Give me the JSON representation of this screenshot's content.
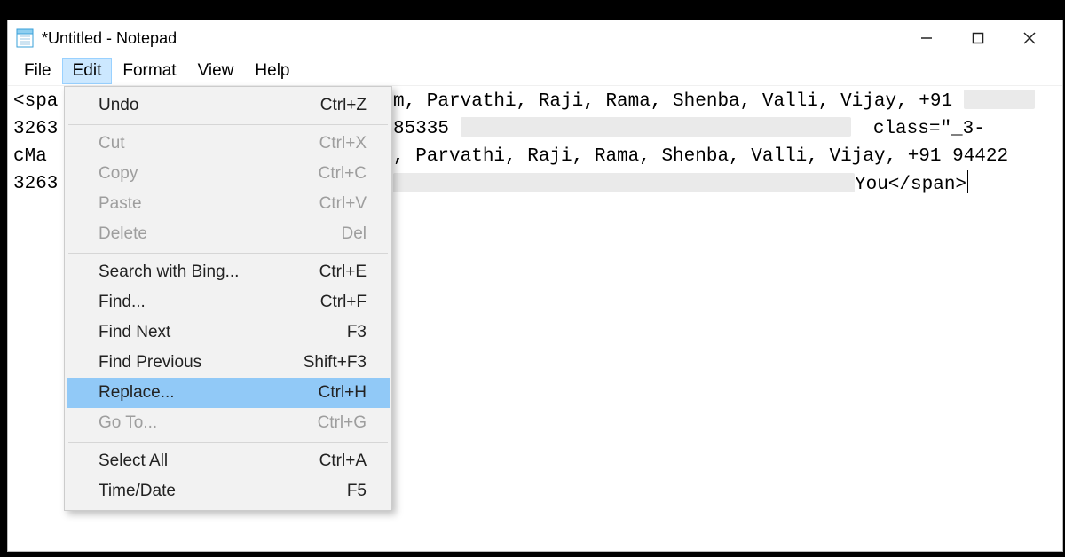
{
  "titlebar": {
    "title": "*Untitled - Notepad"
  },
  "menubar": {
    "file": "File",
    "edit": "Edit",
    "format": "Format",
    "view": "View",
    "help": "Help",
    "active": "edit"
  },
  "editor": {
    "lines": [
      {
        "left": "<spa",
        "right_text": "m, Parvathi, Raji, Rama, Shenba, Valli, Vijay, +91 ",
        "right_tail": ""
      },
      {
        "left": "3263",
        "right_text": "85335",
        "right_tail": "class=\"_3-"
      },
      {
        "left": "cMa",
        "right_text": ", Parvathi, Raji, Rama, Shenba, Valli, Vijay, +91 94422",
        "right_tail": ""
      },
      {
        "left": "3263",
        "right_text": "",
        "right_tail": "You</span>"
      }
    ]
  },
  "edit_menu": {
    "items": [
      {
        "id": "undo",
        "label": "Undo",
        "shortcut": "Ctrl+Z",
        "disabled": false
      },
      {
        "sep": true
      },
      {
        "id": "cut",
        "label": "Cut",
        "shortcut": "Ctrl+X",
        "disabled": true
      },
      {
        "id": "copy",
        "label": "Copy",
        "shortcut": "Ctrl+C",
        "disabled": true
      },
      {
        "id": "paste",
        "label": "Paste",
        "shortcut": "Ctrl+V",
        "disabled": true
      },
      {
        "id": "delete",
        "label": "Delete",
        "shortcut": "Del",
        "disabled": true
      },
      {
        "sep": true
      },
      {
        "id": "bing",
        "label": "Search with Bing...",
        "shortcut": "Ctrl+E",
        "disabled": false
      },
      {
        "id": "find",
        "label": "Find...",
        "shortcut": "Ctrl+F",
        "disabled": false
      },
      {
        "id": "findnext",
        "label": "Find Next",
        "shortcut": "F3",
        "disabled": false
      },
      {
        "id": "findprev",
        "label": "Find Previous",
        "shortcut": "Shift+F3",
        "disabled": false
      },
      {
        "id": "replace",
        "label": "Replace...",
        "shortcut": "Ctrl+H",
        "disabled": false,
        "highlight": true
      },
      {
        "id": "goto",
        "label": "Go To...",
        "shortcut": "Ctrl+G",
        "disabled": true
      },
      {
        "sep": true
      },
      {
        "id": "selectall",
        "label": "Select All",
        "shortcut": "Ctrl+A",
        "disabled": false
      },
      {
        "id": "timedate",
        "label": "Time/Date",
        "shortcut": "F5",
        "disabled": false
      }
    ]
  }
}
